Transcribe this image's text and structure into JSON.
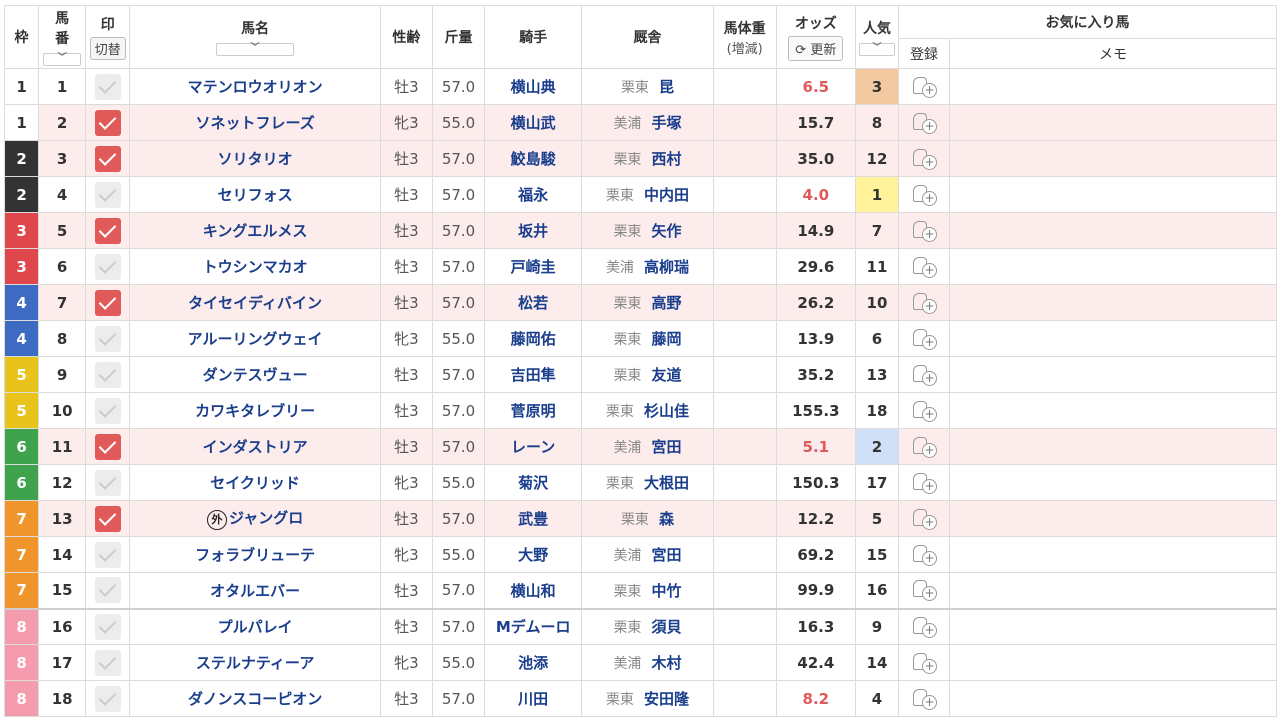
{
  "header": {
    "waku": "枠",
    "umaban_top": "馬",
    "umaban_bottom": "番",
    "mark": "印",
    "mark_switch": "切替",
    "horse_name": "馬名",
    "sex_age": "性齢",
    "weight": "斤量",
    "jockey": "騎手",
    "stable": "厩舎",
    "body_weight": "馬体重",
    "body_weight_sub": "(増減)",
    "odds": "オッズ",
    "refresh": "更新",
    "popularity": "人気",
    "favorites": "お気に入り馬",
    "register": "登録",
    "memo": "メモ",
    "sort_arrow": "﹀"
  },
  "colors": {
    "waku": {
      "1": "#ffffff",
      "2": "#333333",
      "3": "#e0474c",
      "4": "#3e6bc2",
      "5": "#e8c31c",
      "6": "#3fa34d",
      "7": "#f0952b",
      "8": "#f49cae"
    },
    "mark_on": "#e05a5a",
    "odds_hot": "#e05a5a",
    "name_blue": "#1a3e8c"
  },
  "rows": [
    {
      "waku": "1",
      "umaban": "1",
      "marked": false,
      "name": "マテンロウオリオン",
      "foreign": false,
      "sexage": "牡3",
      "weight": "57.0",
      "jockey": "横山典",
      "region": "栗東",
      "trainer": "昆",
      "odds": "6.5",
      "hot": true,
      "ninki": "3"
    },
    {
      "waku": "1",
      "umaban": "2",
      "marked": true,
      "name": "ソネットフレーズ",
      "foreign": false,
      "sexage": "牝3",
      "weight": "55.0",
      "jockey": "横山武",
      "region": "美浦",
      "trainer": "手塚",
      "odds": "15.7",
      "hot": false,
      "ninki": "8"
    },
    {
      "waku": "2",
      "umaban": "3",
      "marked": true,
      "name": "ソリタリオ",
      "foreign": false,
      "sexage": "牡3",
      "weight": "57.0",
      "jockey": "鮫島駿",
      "region": "栗東",
      "trainer": "西村",
      "odds": "35.0",
      "hot": false,
      "ninki": "12"
    },
    {
      "waku": "2",
      "umaban": "4",
      "marked": false,
      "name": "セリフォス",
      "foreign": false,
      "sexage": "牡3",
      "weight": "57.0",
      "jockey": "福永",
      "region": "栗東",
      "trainer": "中内田",
      "odds": "4.0",
      "hot": true,
      "ninki": "1"
    },
    {
      "waku": "3",
      "umaban": "5",
      "marked": true,
      "name": "キングエルメス",
      "foreign": false,
      "sexage": "牡3",
      "weight": "57.0",
      "jockey": "坂井",
      "region": "栗東",
      "trainer": "矢作",
      "odds": "14.9",
      "hot": false,
      "ninki": "7"
    },
    {
      "waku": "3",
      "umaban": "6",
      "marked": false,
      "name": "トウシンマカオ",
      "foreign": false,
      "sexage": "牡3",
      "weight": "57.0",
      "jockey": "戸崎圭",
      "region": "美浦",
      "trainer": "高柳瑞",
      "odds": "29.6",
      "hot": false,
      "ninki": "11"
    },
    {
      "waku": "4",
      "umaban": "7",
      "marked": true,
      "name": "タイセイディバイン",
      "foreign": false,
      "sexage": "牡3",
      "weight": "57.0",
      "jockey": "松若",
      "region": "栗東",
      "trainer": "高野",
      "odds": "26.2",
      "hot": false,
      "ninki": "10"
    },
    {
      "waku": "4",
      "umaban": "8",
      "marked": false,
      "name": "アルーリングウェイ",
      "foreign": false,
      "sexage": "牝3",
      "weight": "55.0",
      "jockey": "藤岡佑",
      "region": "栗東",
      "trainer": "藤岡",
      "odds": "13.9",
      "hot": false,
      "ninki": "6"
    },
    {
      "waku": "5",
      "umaban": "9",
      "marked": false,
      "name": "ダンテスヴュー",
      "foreign": false,
      "sexage": "牡3",
      "weight": "57.0",
      "jockey": "吉田隼",
      "region": "栗東",
      "trainer": "友道",
      "odds": "35.2",
      "hot": false,
      "ninki": "13"
    },
    {
      "waku": "5",
      "umaban": "10",
      "marked": false,
      "name": "カワキタレブリー",
      "foreign": false,
      "sexage": "牡3",
      "weight": "57.0",
      "jockey": "菅原明",
      "region": "栗東",
      "trainer": "杉山佳",
      "odds": "155.3",
      "hot": false,
      "ninki": "18"
    },
    {
      "waku": "6",
      "umaban": "11",
      "marked": true,
      "name": "インダストリア",
      "foreign": false,
      "sexage": "牡3",
      "weight": "57.0",
      "jockey": "レーン",
      "region": "美浦",
      "trainer": "宮田",
      "odds": "5.1",
      "hot": true,
      "ninki": "2"
    },
    {
      "waku": "6",
      "umaban": "12",
      "marked": false,
      "name": "セイクリッド",
      "foreign": false,
      "sexage": "牝3",
      "weight": "55.0",
      "jockey": "菊沢",
      "region": "栗東",
      "trainer": "大根田",
      "odds": "150.3",
      "hot": false,
      "ninki": "17"
    },
    {
      "waku": "7",
      "umaban": "13",
      "marked": true,
      "name": "ジャングロ",
      "foreign": true,
      "sexage": "牡3",
      "weight": "57.0",
      "jockey": "武豊",
      "region": "栗東",
      "trainer": "森",
      "odds": "12.2",
      "hot": false,
      "ninki": "5"
    },
    {
      "waku": "7",
      "umaban": "14",
      "marked": false,
      "name": "フォラブリューテ",
      "foreign": false,
      "sexage": "牝3",
      "weight": "55.0",
      "jockey": "大野",
      "region": "美浦",
      "trainer": "宮田",
      "odds": "69.2",
      "hot": false,
      "ninki": "15"
    },
    {
      "waku": "7",
      "umaban": "15",
      "marked": false,
      "name": "オタルエバー",
      "foreign": false,
      "sexage": "牡3",
      "weight": "57.0",
      "jockey": "横山和",
      "region": "栗東",
      "trainer": "中竹",
      "odds": "99.9",
      "hot": false,
      "ninki": "16"
    },
    {
      "waku": "8",
      "umaban": "16",
      "marked": false,
      "name": "プルパレイ",
      "foreign": false,
      "sexage": "牡3",
      "weight": "57.0",
      "jockey": "Mデムーロ",
      "region": "栗東",
      "trainer": "須貝",
      "odds": "16.3",
      "hot": false,
      "ninki": "9"
    },
    {
      "waku": "8",
      "umaban": "17",
      "marked": false,
      "name": "ステルナティーア",
      "foreign": false,
      "sexage": "牝3",
      "weight": "55.0",
      "jockey": "池添",
      "region": "美浦",
      "trainer": "木村",
      "odds": "42.4",
      "hot": false,
      "ninki": "14"
    },
    {
      "waku": "8",
      "umaban": "18",
      "marked": false,
      "name": "ダノンスコーピオン",
      "foreign": false,
      "sexage": "牡3",
      "weight": "57.0",
      "jockey": "川田",
      "region": "栗東",
      "trainer": "安田隆",
      "odds": "8.2",
      "hot": true,
      "ninki": "4"
    }
  ],
  "foreign_mark": "外"
}
